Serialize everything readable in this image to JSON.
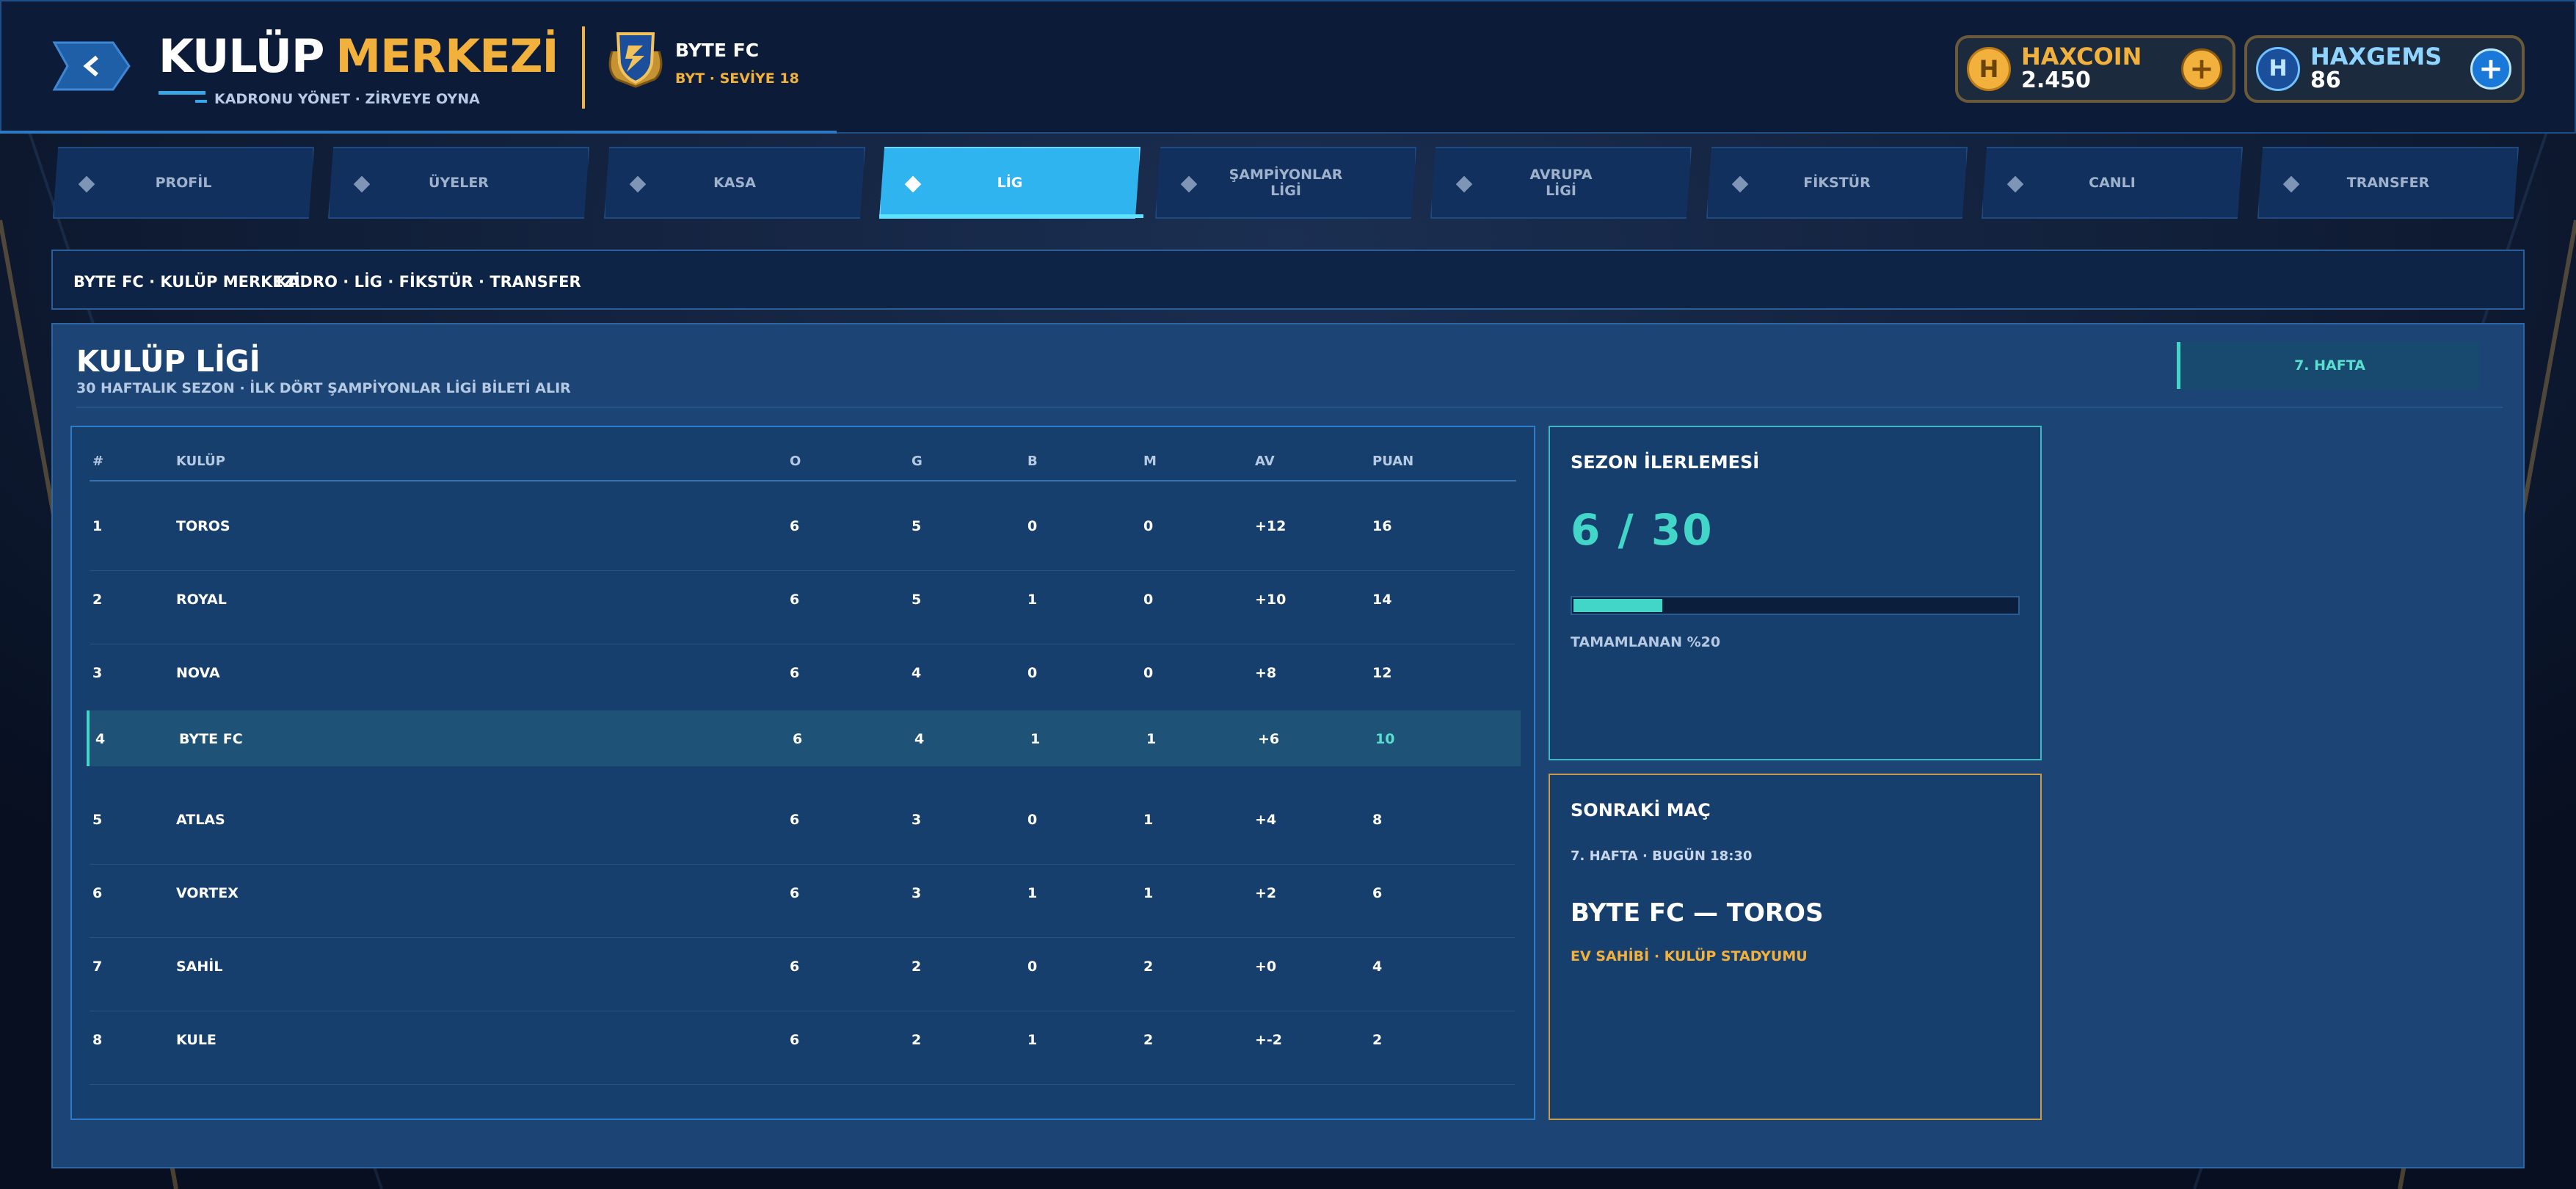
{
  "header": {
    "title_word1": "KULÜP",
    "title_word2": "MERKEZİ",
    "subtitle": "KADRONU YÖNET · ZİRVEYE OYNA",
    "club_name": "BYTE FC",
    "club_subtitle": "BYT · SEVİYE 18"
  },
  "currencies": {
    "haxcoin": {
      "name": "HAXCOIN",
      "value": "2.450",
      "icon": "haxcoin-icon",
      "plus": "+"
    },
    "haxgems": {
      "name": "HAXGEMS",
      "value": "86",
      "icon": "haxgems-icon",
      "plus": "+"
    }
  },
  "tabs": [
    {
      "label": "PROFİL",
      "active": false
    },
    {
      "label": "ÜYELER",
      "active": false
    },
    {
      "label": "KASA",
      "active": false
    },
    {
      "label": "LİG",
      "active": true
    },
    {
      "label": "ŞAMPİYONLAR\nLİGİ",
      "active": false
    },
    {
      "label": "AVRUPA\nLİGİ",
      "active": false
    },
    {
      "label": "FİKSTÜR",
      "active": false
    },
    {
      "label": "CANLI",
      "active": false
    },
    {
      "label": "TRANSFER",
      "active": false
    }
  ],
  "breadcrumb": {
    "path": "BYTE FC · KULÜP MERKEZİ",
    "links": "KADRO · LİG · FİKSTÜR · TRANSFER"
  },
  "page": {
    "title": "KULÜP LİGİ",
    "subtitle": "30 HAFTALIK SEZON · İLK DÖRT ŞAMPİYONLAR LİGİ BİLETİ ALIR",
    "week_chip": "7. HAFTA"
  },
  "standings": {
    "columns": [
      "#",
      "KULÜP",
      "O",
      "G",
      "B",
      "M",
      "AV",
      "PUAN"
    ],
    "rows": [
      [
        "1",
        "TOROS",
        "6",
        "5",
        "0",
        "0",
        "+12",
        "16"
      ],
      [
        "2",
        "ROYAL",
        "6",
        "5",
        "1",
        "0",
        "+10",
        "14"
      ],
      [
        "3",
        "NOVA",
        "6",
        "4",
        "0",
        "0",
        "+8",
        "12"
      ],
      [
        "4",
        "BYTE FC",
        "6",
        "4",
        "1",
        "1",
        "+6",
        "10"
      ],
      [
        "5",
        "ATLAS",
        "6",
        "3",
        "0",
        "1",
        "+4",
        "8"
      ],
      [
        "6",
        "VORTEX",
        "6",
        "3",
        "1",
        "1",
        "+2",
        "6"
      ],
      [
        "7",
        "SAHİL",
        "6",
        "2",
        "0",
        "2",
        "+0",
        "4"
      ],
      [
        "8",
        "KULE",
        "6",
        "2",
        "1",
        "2",
        "+-2",
        "2"
      ]
    ],
    "highlight_row": 3
  },
  "season_progress": {
    "title": "SEZON İLERLEMESİ",
    "value": "6 / 30",
    "fraction": 0.2,
    "label": "TAMAMLANAN  %20"
  },
  "next_match": {
    "title": "SONRAKİ MAÇ",
    "when": "7. HAFTA · BUGÜN 18:30",
    "match": "BYTE FC — TOROS",
    "venue": "EV SAHİBİ · KULÜP STADYUMU"
  },
  "colors": {
    "accent_gold": "#f2b13c",
    "accent_cyan": "#42d6c9",
    "tab_active": "#2fb4f0",
    "panel_blue": "#1c4576"
  }
}
